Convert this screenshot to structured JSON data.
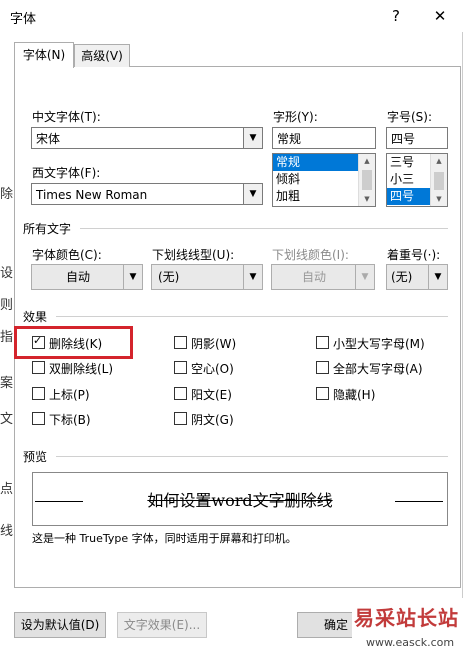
{
  "window": {
    "title": "字体",
    "help": "?",
    "close": "✕"
  },
  "tabs": [
    {
      "label": "字体(N)"
    },
    {
      "label": "高级(V)"
    }
  ],
  "font": {
    "cn_label": "中文字体(T):",
    "cn_value": "宋体",
    "west_label": "西文字体(F):",
    "west_value": "Times New Roman",
    "style_label": "字形(Y):",
    "style_value": "常规",
    "style_items": [
      "常规",
      "倾斜",
      "加粗"
    ],
    "size_label": "字号(S):",
    "size_value": "四号",
    "size_items": [
      "三号",
      "小三",
      "四号"
    ]
  },
  "all_text": {
    "header": "所有文字",
    "color_label": "字体颜色(C):",
    "color_value": "自动",
    "underline_label": "下划线线型(U):",
    "underline_value": "(无)",
    "underline_color_label": "下划线颜色(I):",
    "underline_color_value": "自动",
    "emphasis_label": "着重号(·):",
    "emphasis_value": "(无)"
  },
  "effects": {
    "header": "效果",
    "items": [
      {
        "label": "删除线(K)",
        "checked": true
      },
      {
        "label": "双删除线(L)",
        "checked": false
      },
      {
        "label": "上标(P)",
        "checked": false
      },
      {
        "label": "下标(B)",
        "checked": false
      },
      {
        "label": "阴影(W)",
        "checked": false
      },
      {
        "label": "空心(O)",
        "checked": false
      },
      {
        "label": "阳文(E)",
        "checked": false
      },
      {
        "label": "阴文(G)",
        "checked": false
      },
      {
        "label": "小型大写字母(M)",
        "checked": false
      },
      {
        "label": "全部大写字母(A)",
        "checked": false
      },
      {
        "label": "隐藏(H)",
        "checked": false
      }
    ]
  },
  "preview": {
    "header": "预览",
    "text": "如何设置word文字删除线",
    "note": "这是一种 TrueType 字体，同时适用于屏幕和打印机。"
  },
  "buttons": {
    "default": "设为默认值(D)",
    "text_effects": "文字效果(E)...",
    "ok": "确定"
  },
  "left_edge_chars": [
    "除",
    "设",
    "则",
    "指",
    "案",
    "文",
    "点",
    "线"
  ],
  "watermark": {
    "main": "易采站长站",
    "url": "www.easck.com"
  }
}
